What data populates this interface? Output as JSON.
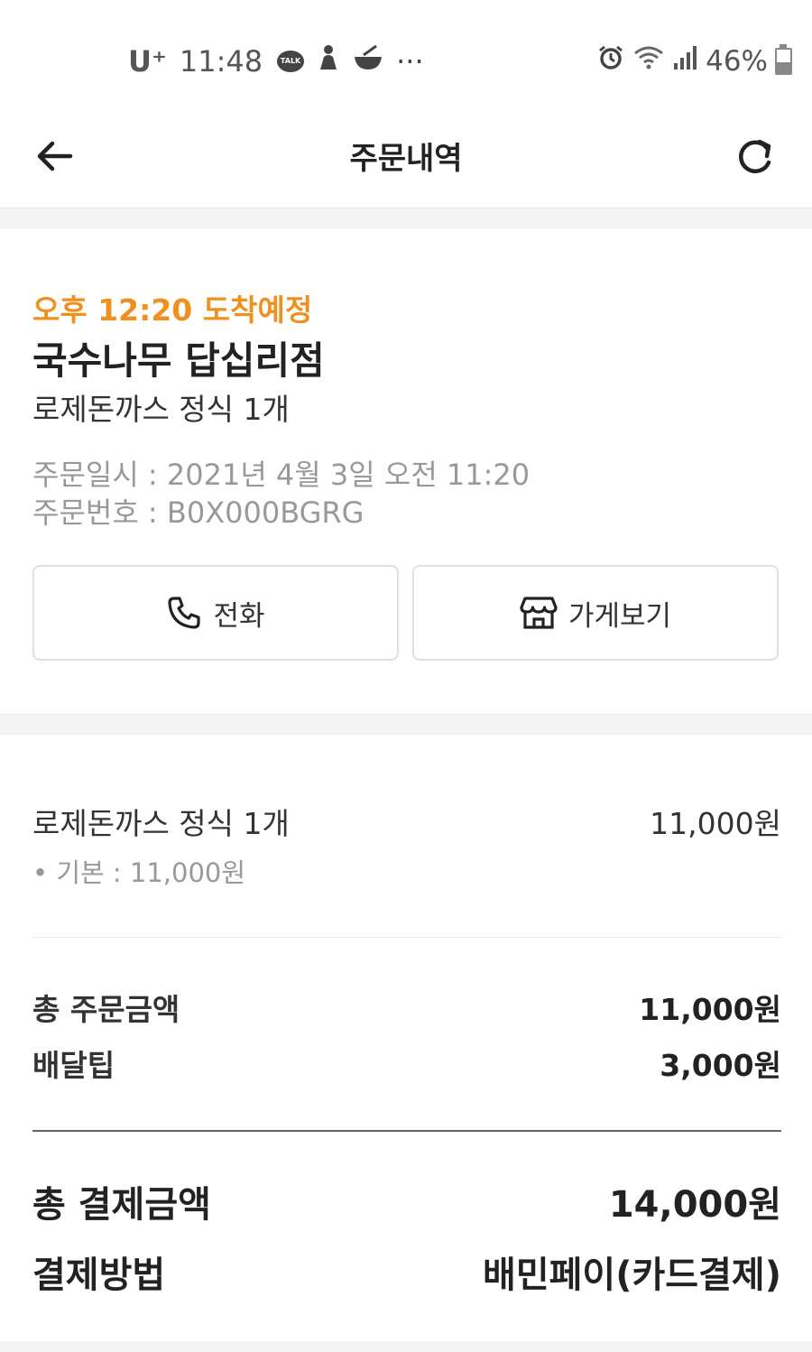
{
  "status_bar": {
    "carrier": "U⁺",
    "time": "11:48",
    "talk_badge": "TALK",
    "more": "···",
    "battery_percent": "46%",
    "icons": [
      "kakaotalk-icon",
      "figure-icon",
      "bowl-icon",
      "alarm-icon",
      "wifi-icon",
      "signal-icon",
      "battery-icon"
    ]
  },
  "app_bar": {
    "title": "주문내역",
    "back_icon": "arrow-left-icon",
    "refresh_icon": "refresh-icon"
  },
  "order": {
    "eta": "오후 12:20 도착예정",
    "store_name": "국수나무 답십리점",
    "menu_summary": "로제돈까스 정식 1개",
    "order_datetime": "주문일시 : 2021년 4월 3일 오전 11:20",
    "order_number": "주문번호 : B0X000BGRG",
    "accent_color": "#f0901e",
    "buttons": {
      "call_label": "전화",
      "store_label": "가게보기"
    }
  },
  "details": {
    "items": [
      {
        "name": "로제돈까스 정식 1개",
        "price": "11,000원",
        "option": "• 기본 : 11,000원"
      }
    ],
    "total_order_label": "총 주문금액",
    "total_order_value": "11,000원",
    "delivery_tip_label": "배달팁",
    "delivery_tip_value": "3,000원",
    "total_payment_label": "총 결제금액",
    "total_payment_value": "14,000원",
    "payment_method_label": "결제방법",
    "payment_method_value": "배민페이(카드결제)"
  }
}
